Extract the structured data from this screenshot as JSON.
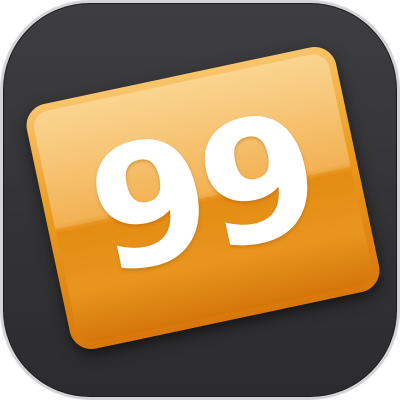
{
  "app_icon": {
    "name": "counter-app",
    "number": "99",
    "colors": {
      "background": "#333335",
      "tile": "#f1a63a",
      "tile_dark": "#e48c12",
      "number": "#ffffff"
    }
  }
}
